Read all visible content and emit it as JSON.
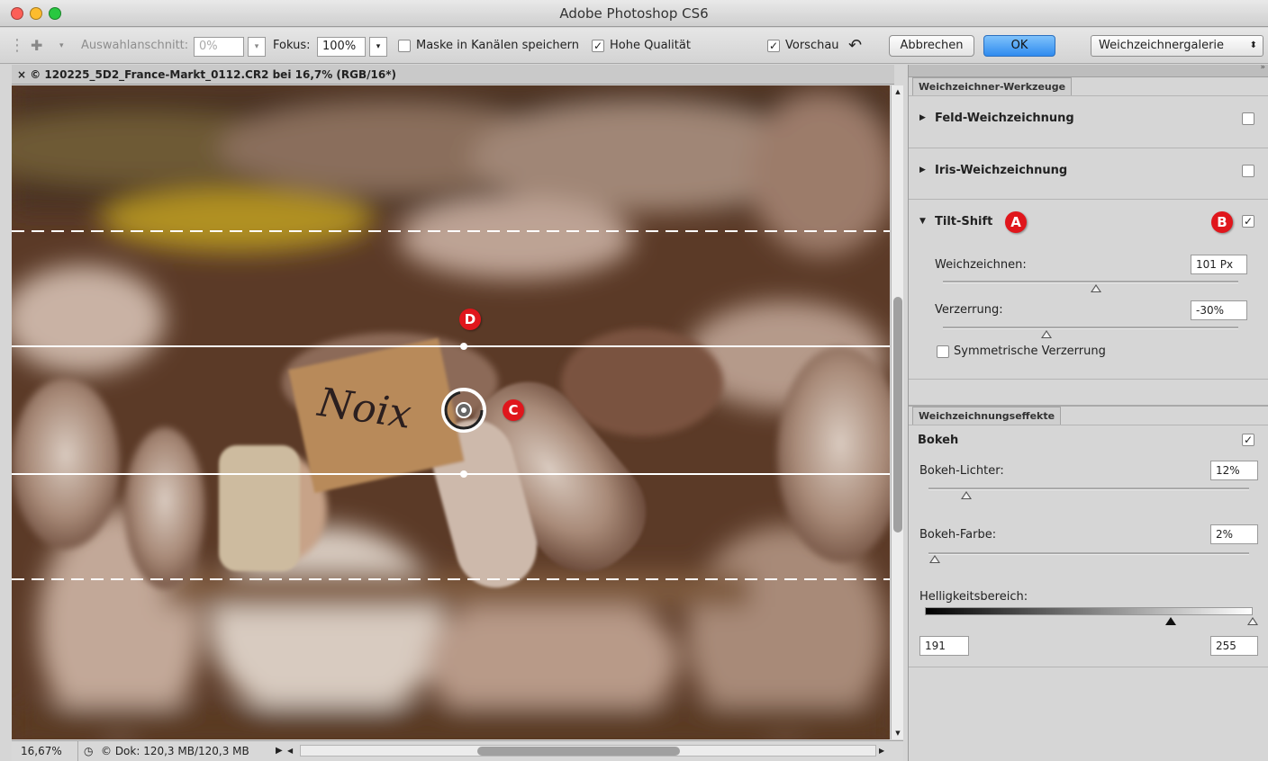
{
  "window": {
    "title": "Adobe Photoshop CS6"
  },
  "toolbar": {
    "selection_label": "Auswahlanschnitt:",
    "selection_value": "0%",
    "focus_label": "Fokus:",
    "focus_value": "100%",
    "mask_label": "Maske in Kanälen speichern",
    "mask_checked": false,
    "quality_label": "Hohe Qualität",
    "quality_checked": true,
    "preview_label": "Vorschau",
    "preview_checked": true,
    "cancel_label": "Abbrechen",
    "ok_label": "OK",
    "gallery_value": "Weichzeichnergalerie"
  },
  "document": {
    "tab_label": "× © 120225_5D2_France-Markt_0112.CR2 bei 16,7% (RGB/16*)",
    "sign_text": "Noix"
  },
  "status": {
    "zoom": "16,67%",
    "doc_info": "© Dok: 120,3 MB/120,3 MB"
  },
  "tools_panel": {
    "tab_label": "Weichzeichner-Werkzeuge",
    "field_blur": {
      "label": "Feld-Weichzeichnung",
      "checked": false
    },
    "iris_blur": {
      "label": "Iris-Weichzeichnung",
      "checked": false
    },
    "tilt_shift": {
      "label": "Tilt-Shift",
      "checked": true,
      "blur_label": "Weichzeichnen:",
      "blur_value": "101 Px",
      "distortion_label": "Verzerrung:",
      "distortion_value": "-30%",
      "symmetric_label": "Symmetrische Verzerrung",
      "symmetric_checked": false
    }
  },
  "effects_panel": {
    "tab_label": "Weichzeichnungseffekte",
    "bokeh_label": "Bokeh",
    "bokeh_checked": true,
    "light_label": "Bokeh-Lichter:",
    "light_value": "12%",
    "color_label": "Bokeh-Farbe:",
    "color_value": "2%",
    "range_label": "Helligkeitsbereich:",
    "range_low": "191",
    "range_high": "255"
  },
  "callouts": {
    "a": "A",
    "b": "B",
    "c": "C",
    "d": "D"
  },
  "colors": {
    "accent": "#2f8bef",
    "callout": "#e0161c"
  }
}
